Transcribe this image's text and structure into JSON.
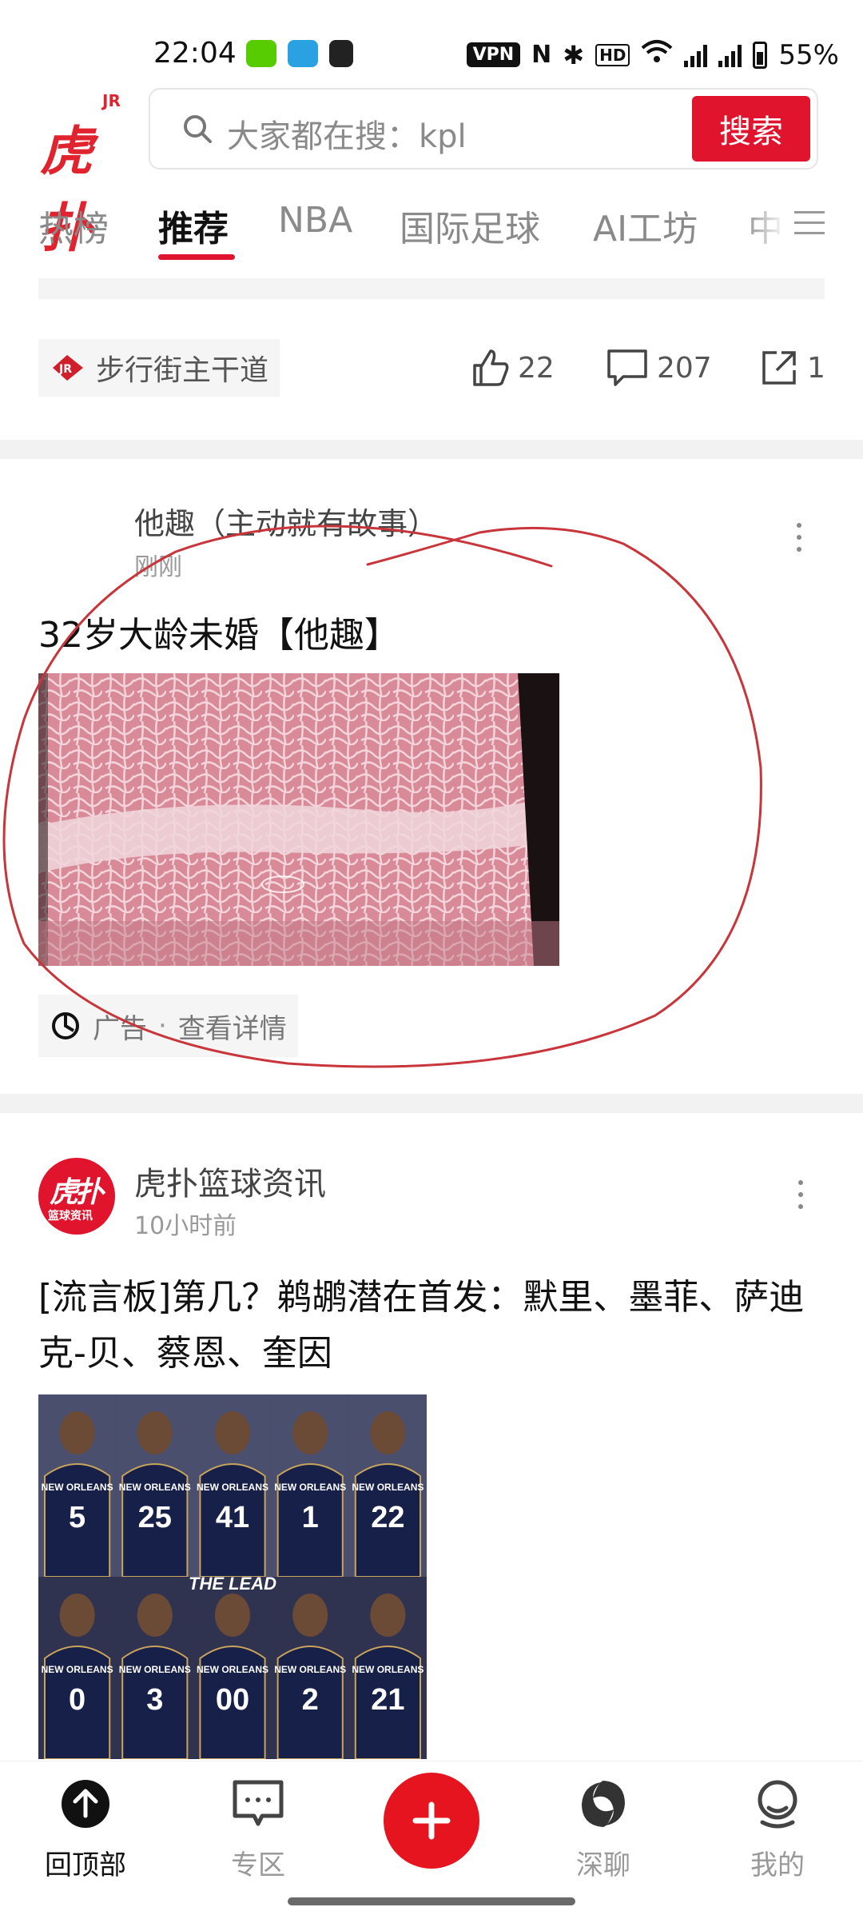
{
  "status_bar": {
    "time": "22:04",
    "vpn": "VPN",
    "battery": "55%",
    "icons": [
      "duolingo-icon",
      "telegram-icon",
      "app-icon",
      "nfc-icon",
      "bluetooth-icon",
      "hd-icon",
      "wifi-icon",
      "5g-signal-icon",
      "5g-signal-icon",
      "battery-icon"
    ]
  },
  "header": {
    "logo_text": "虎扑",
    "logo_badge": "JR",
    "search_placeholder": "大家都在搜：kpl",
    "search_button": "搜索"
  },
  "tabs": [
    {
      "label": "热榜",
      "active": false
    },
    {
      "label": "推荐",
      "active": true
    },
    {
      "label": "NBA",
      "active": false
    },
    {
      "label": "国际足球",
      "active": false
    },
    {
      "label": "AI工坊",
      "active": false
    },
    {
      "label": "中",
      "active": false
    }
  ],
  "prev_post": {
    "board": "步行街主干道",
    "likes": "22",
    "comments": "207",
    "shares": "1"
  },
  "ad_post": {
    "author": "他趣（主动就有故事）",
    "time": "刚刚",
    "title": "32岁大龄未婚【他趣】",
    "ad_label": "广告",
    "ad_separator": "·",
    "ad_link": "查看详情",
    "image_desc_icon": "marbled-beef-image"
  },
  "news_post": {
    "author": "虎扑篮球资讯",
    "avatar_text": "虎扑",
    "avatar_sub": "篮球资讯",
    "time": "10小时前",
    "title": "[流言板]第几？鹈鹕潜在首发：默里、墨菲、萨迪克-贝、蔡恩、奎因",
    "players_top": [
      "5",
      "25",
      "41",
      "1",
      "22"
    ],
    "players_bottom": [
      "0",
      "3",
      "00",
      "2",
      "21"
    ],
    "jersey_text": "NEW ORLEANS",
    "banner_text": "THE LEAD"
  },
  "bottom_nav": [
    {
      "label": "回顶部",
      "icon": "arrow-up-icon",
      "active": true
    },
    {
      "label": "专区",
      "icon": "chat-board-icon",
      "active": false
    },
    {
      "label": "",
      "icon": "plus-icon",
      "active": false
    },
    {
      "label": "深聊",
      "icon": "swirl-icon",
      "active": false
    },
    {
      "label": "我的",
      "icon": "profile-icon",
      "active": false
    }
  ],
  "colors": {
    "brand_red": "#e0142c",
    "text_gray": "#8a8a8a",
    "annotation_red": "#c8353a"
  }
}
